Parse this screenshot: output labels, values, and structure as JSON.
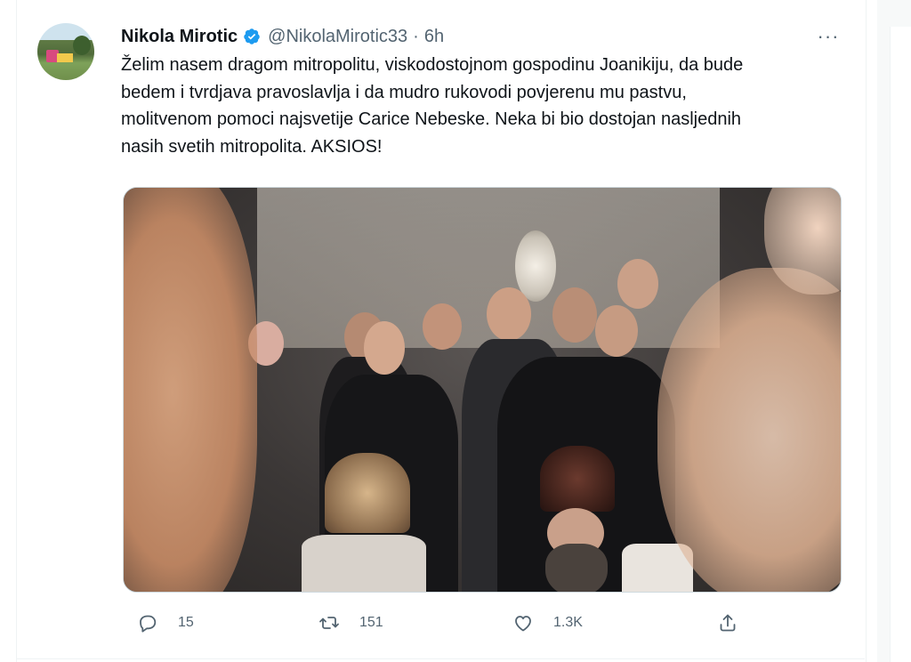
{
  "tweet": {
    "author_name": "Nikola Mirotic",
    "handle": "@NikolaMirotic33",
    "separator": "·",
    "time": "6h",
    "text": "Želim nasem dragom mitropolitu, viskodostojnom gospodinu Joanikiju, da bude bedem i tvrdjava pravoslavlja i da mudro rukovodi povjerenu mu pastvu, molitvenom pomoci najsvetije Carice Nebeske. Neka bi bio dostojan nasljednih nasih svetih mitropolita. AKSIOS!",
    "more_label": "···",
    "verified": true,
    "icons": {
      "verified": "verified-badge-icon",
      "more": "more-icon",
      "reply": "reply-icon",
      "retweet": "retweet-icon",
      "like": "like-icon",
      "share": "share-icon"
    }
  },
  "actions": {
    "replies": "15",
    "retweets": "151",
    "likes": "1.3K"
  },
  "colors": {
    "text": "#0f1419",
    "secondary": "#536471",
    "verified": "#1d9bf0",
    "border": "#cfd9de"
  }
}
